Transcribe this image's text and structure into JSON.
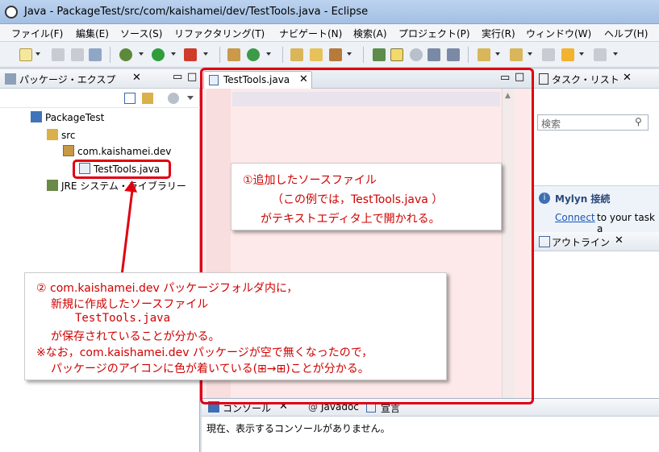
{
  "window": {
    "title": "Java - PackageTest/src/com/kaishamei/dev/TestTools.java - Eclipse"
  },
  "menu": [
    "ファイル(F)",
    "編集(E)",
    "ソース(S)",
    "リファクタリング(T)",
    "ナビゲート(N)",
    "検索(A)",
    "プロジェクト(P)",
    "実行(R)",
    "ウィンドウ(W)",
    "ヘルプ(H)"
  ],
  "package_explorer": {
    "title": "パッケージ・エクスプ",
    "tree": {
      "project": "PackageTest",
      "src": "src",
      "package": "com.kaishamei.dev",
      "file": "TestTools.java",
      "jre": "JRE システム・ライブラリー"
    }
  },
  "editor": {
    "tab": "TestTools.java"
  },
  "task_list": {
    "title": "タスク・リスト",
    "search_placeholder": "検索"
  },
  "mylyn": {
    "title": "Mylyn 接続",
    "link": "Connect",
    "text": "to your task a"
  },
  "outline": {
    "title": "アウトライン"
  },
  "console": {
    "tabs": [
      "コンソール",
      "Javadoc",
      "宣言"
    ],
    "message": "現在、表示するコンソールがありません。"
  },
  "callout1": {
    "line1": "①追加したソースファイル",
    "line2": "（この例では，TestTools.java ）",
    "line3": "がテキストエディタ上で開かれる。"
  },
  "callout2": {
    "line1": "② com.kaishamei.dev パッケージフォルダ内に，",
    "line2": "新規に作成したソースファイル",
    "line3": "TestTools.java",
    "line4": "が保存されていることが分かる。",
    "line5": "※なお，com.kaishamei.dev パッケージが空で無くなったので，",
    "line6": "パッケージのアイコンに色が着いている(⊞→⊞)ことが分かる。"
  },
  "colors": {
    "accent_red": "#e00010",
    "editor_bg": "#fde9e9"
  }
}
